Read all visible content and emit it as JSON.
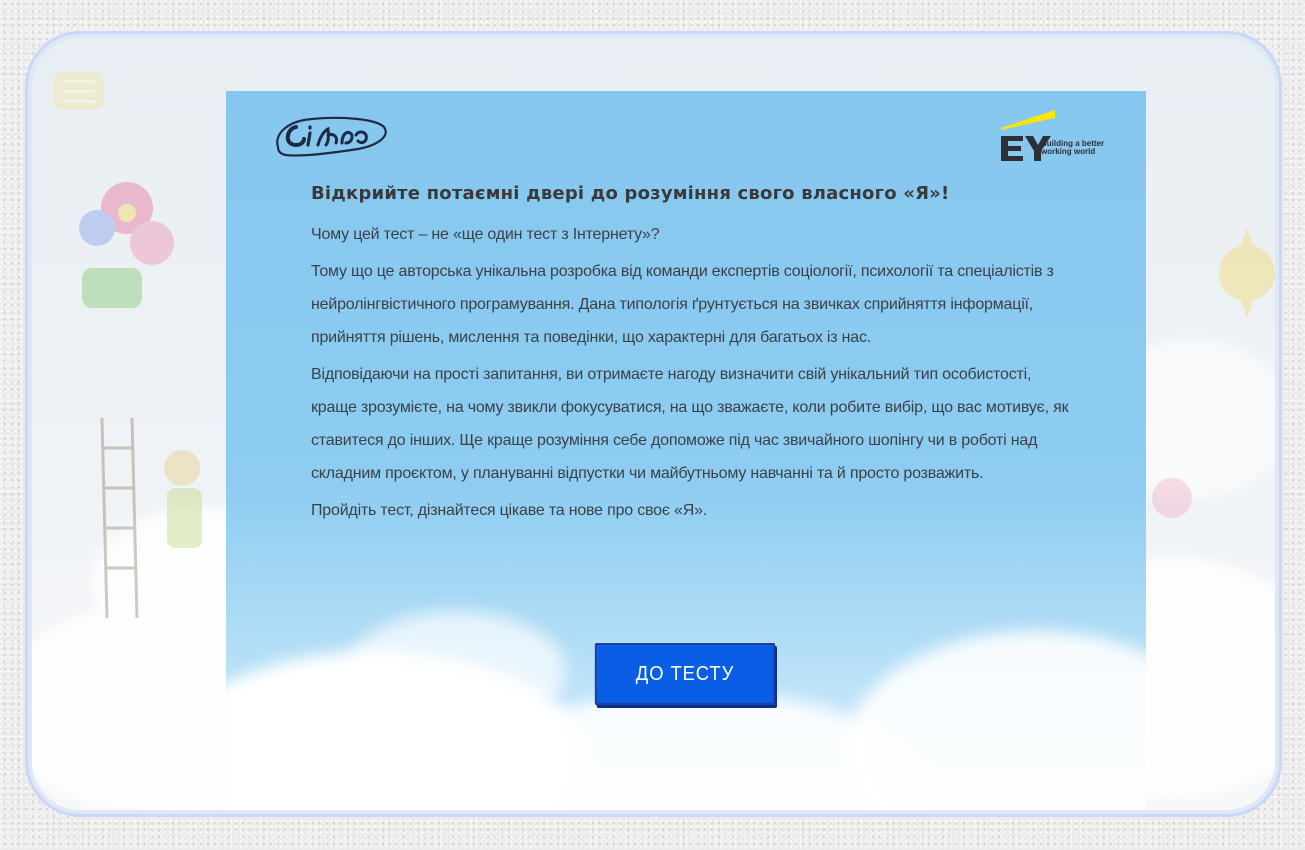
{
  "header": {
    "menu_icon": "hamburger-icon",
    "brand_logo": "Сільпо",
    "partner_logo": "EY",
    "partner_tagline": "Building a better\nworking world"
  },
  "intro": {
    "heading": "Відкрийте потаємні двері до розуміння свого власного «Я»!",
    "paragraphs": [
      "Чому цей тест – не «ще один тест з Інтернету»?",
      "Тому що це авторська унікальна розробка від команди експертів соціології, психології та спеціалістів з нейролінгвістичного програмування. Дана типологія ґрунтується на звичках сприйняття інформації, прийняття рішень, мислення та поведінки, що характерні для багатьох із нас.",
      "Відповідаючи на прості запитання, ви отримаєте нагоду визначити свій унікальний тип особистості, краще зрозумієте, на чому звикли фокусуватися, на що зважаєте, коли робите вибір, що вас мотивує, як ставитеся до інших. Ще краще розуміння себе допоможе під час звичайного шопінгу чи в роботі над складним проєктом, у плануванні відпустки чи майбутньому навчанні та й просто розважить.",
      "Пройдіть тест, дізнайтеся цікаве та нове про своє «Я»."
    ],
    "cta_label": "ДО ТЕСТУ"
  },
  "colors": {
    "panel_sky": "#86c7ef",
    "button": "#0a5ee6",
    "ey_yellow": "#ffe600",
    "text": "#3b4147"
  }
}
